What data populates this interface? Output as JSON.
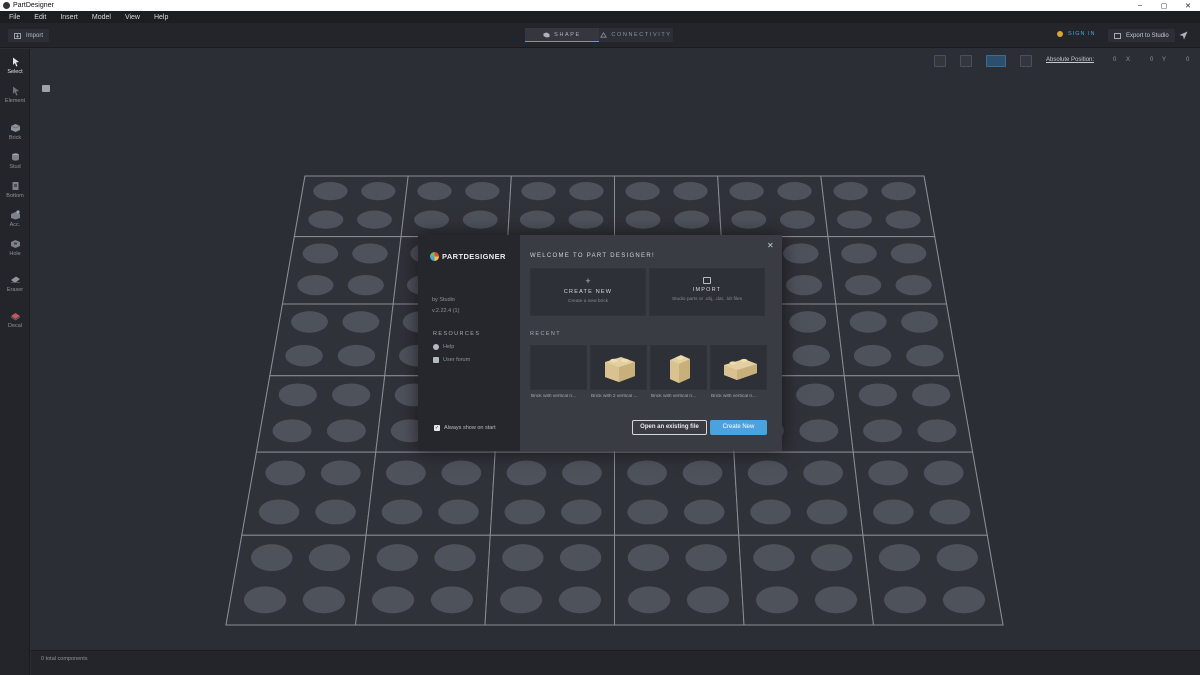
{
  "window": {
    "title": "PartDesigner",
    "minimize": "–",
    "maximize": "▢",
    "close": "✕"
  },
  "menu": [
    "File",
    "Edit",
    "Insert",
    "Model",
    "View",
    "Help"
  ],
  "toolbar": {
    "import_label": "Import",
    "tabs": [
      {
        "label": "SHAPE",
        "active": true
      },
      {
        "label": "CONNECTIVITY",
        "active": false
      }
    ],
    "sign_in": "SIGN IN",
    "export_label": "Export to Studio"
  },
  "tools": [
    {
      "label": "Select",
      "icon": "select-arrow-icon",
      "active": true
    },
    {
      "label": "Element",
      "icon": "element-arrow-icon",
      "active": false
    },
    {
      "label": "Brick",
      "icon": "brick-icon",
      "active": false
    },
    {
      "label": "Stud",
      "icon": "stud-icon",
      "active": false
    },
    {
      "label": "Bottom",
      "icon": "bottom-icon",
      "active": false
    },
    {
      "label": "Acc.",
      "icon": "accessory-icon",
      "active": false
    },
    {
      "label": "Hole",
      "icon": "hole-icon",
      "active": false
    },
    {
      "label": "Eraser",
      "icon": "eraser-icon",
      "active": false
    },
    {
      "label": "Decal",
      "icon": "decal-icon",
      "active": false
    }
  ],
  "position_bar": {
    "label": "Absolute Position:",
    "x_value": "0",
    "x_axis": "X",
    "y_value": "0",
    "y_axis": "Y",
    "z_value": "0"
  },
  "status": {
    "text": "0 total components"
  },
  "welcome": {
    "brand": "PARTDESIGNER",
    "by": "by Studio",
    "version": "v.2.22.4 (1)",
    "resources_title": "RESOURCES",
    "resources": [
      {
        "label": "Help"
      },
      {
        "label": "User forum"
      }
    ],
    "always_show": "Always show on start",
    "title": "WELCOME TO PART DESIGNER!",
    "create_card": {
      "title": "CREATE NEW",
      "subtitle": "Create a new brick"
    },
    "import_card": {
      "title": "IMPORT",
      "subtitle": "Studio parts or .obj, .dat, .ldr files"
    },
    "recent_title": "RECENT",
    "recent": [
      {
        "label": "Brick with vertical ri..."
      },
      {
        "label": "Brick with 2 vertical ..."
      },
      {
        "label": "Brick with vertical ri..."
      },
      {
        "label": "Brick with vertical ri..."
      }
    ],
    "open_existing": "Open an existing file",
    "create_new_button": "Create New"
  },
  "colors": {
    "accent": "#4aa3df",
    "baseplate": "#2f3238",
    "stud": "#4e525a",
    "brick": "#d9c28f"
  }
}
